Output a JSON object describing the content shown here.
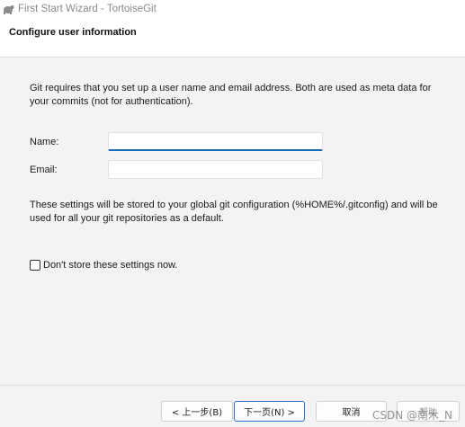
{
  "window": {
    "title": "First Start Wizard - TortoiseGit",
    "icon": "tortoisegit-app-icon"
  },
  "header": {
    "heading": "Configure user information"
  },
  "main": {
    "intro_text": "Git requires that you set up a user name and email address. Both are used as meta data for your commits (not for authentication).",
    "name_label": "Name:",
    "name_value": "",
    "email_label": "Email:",
    "email_value": "",
    "storage_text": "These settings will be stored to your global git configuration (%HOME%/.gitconfig) and will be used for all your git repositories as a default.",
    "dont_store_label": "Don't store these settings now.",
    "dont_store_checked": false
  },
  "footer": {
    "back_label": "< 上一步(B)",
    "next_label": "下一页(N) >",
    "cancel_label": "取消",
    "help_label": "帮助",
    "watermark": "CSDN @南木_N"
  }
}
